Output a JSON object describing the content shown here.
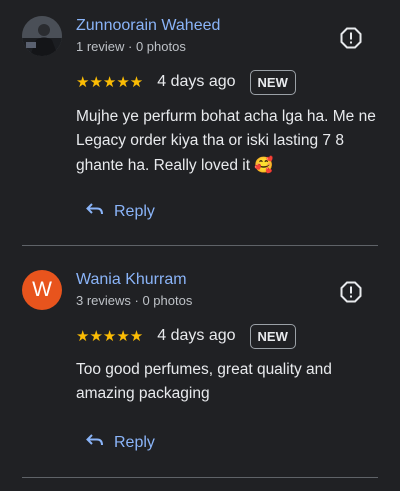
{
  "reviews": [
    {
      "avatar_type": "photo",
      "author": "Zunnoorain Waheed",
      "meta": "1 review · 0 photos",
      "stars": "★★★★★",
      "date": "4 days ago",
      "badge": "NEW",
      "text": "Mujhe ye perfurm bohat acha lga ha. Me ne Legacy order kiya tha or iski lasting 7 8 ghante ha. Really loved it",
      "emoji": "🥰",
      "reply_label": "Reply"
    },
    {
      "avatar_type": "letter",
      "avatar_letter": "W",
      "author": "Wania Khurram",
      "meta": "3 reviews · 0 photos",
      "stars": "★★★★★",
      "date": "4 days ago",
      "badge": "NEW",
      "text": "Too good perfumes, great quality and amazing packaging",
      "reply_label": "Reply"
    }
  ],
  "colors": {
    "background": "#202124",
    "link": "#8ab4f8",
    "star": "#fbbc04",
    "avatar_letter_bg": "#e8541d"
  }
}
